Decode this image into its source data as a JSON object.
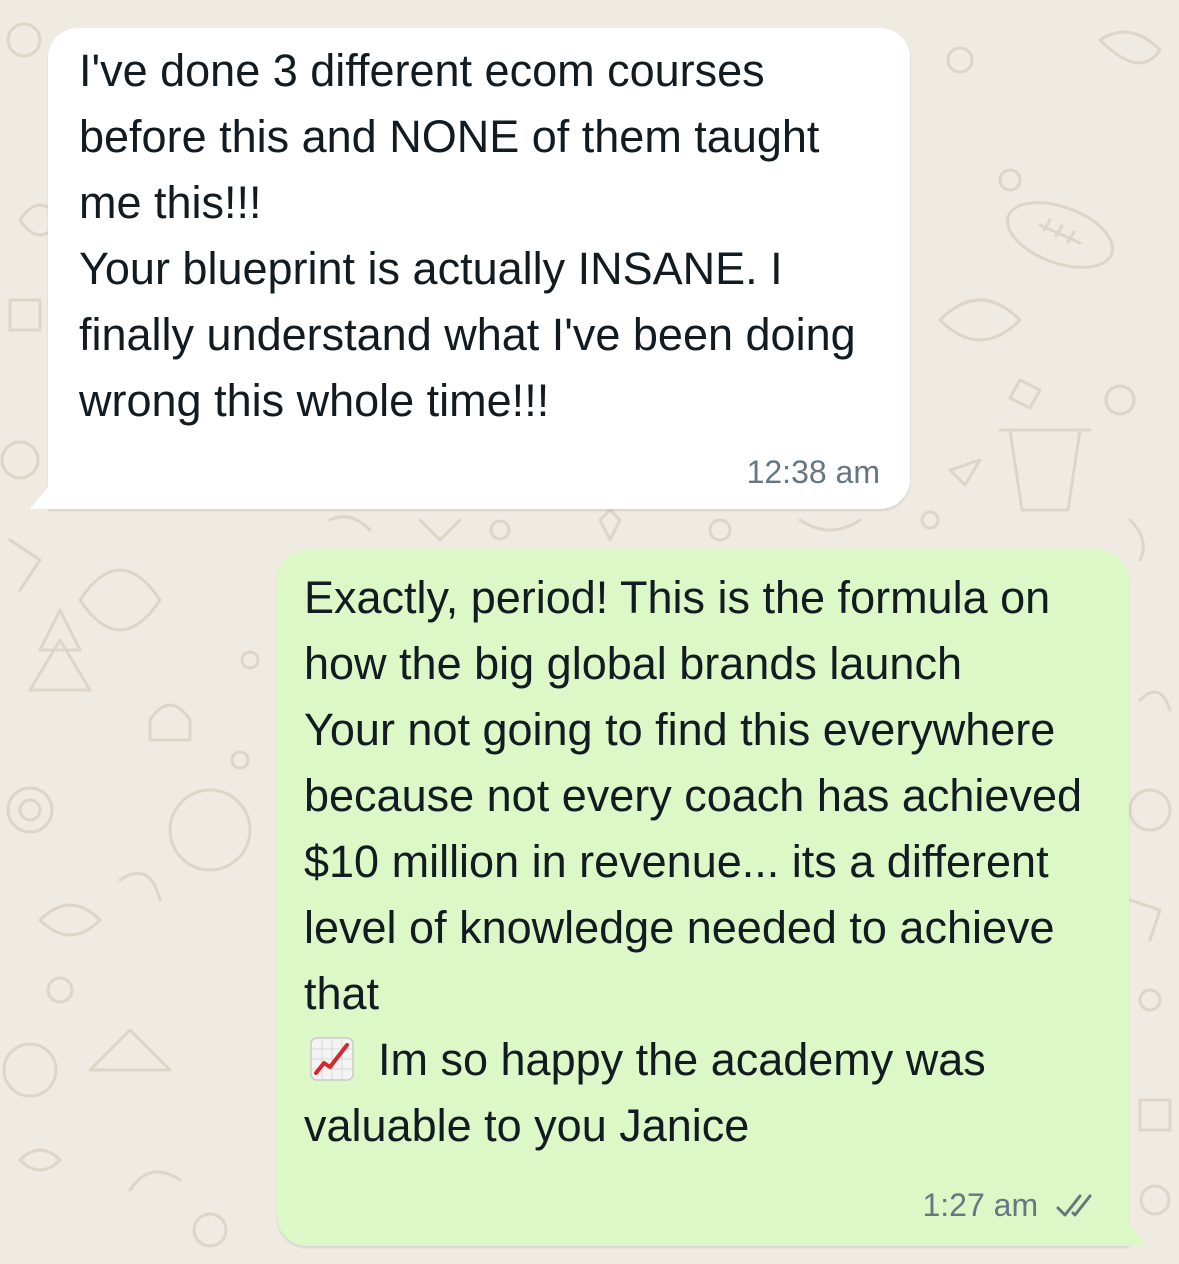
{
  "theme": {
    "wallpaper_color": "#efeae2",
    "incoming_bubble_color": "#ffffff",
    "outgoing_bubble_color": "#dcf8c6",
    "timestamp_color": "#667781"
  },
  "messages": [
    {
      "direction": "incoming",
      "text": "I've done 3 different ecom courses before this and NONE of them taught me this!!!\nYour blueprint is actually INSANE. I finally understand what I've been doing wrong this whole time!!!",
      "time": "12:38 am"
    },
    {
      "direction": "outgoing",
      "text_before_emoji": "Exactly, period! This is the formula on how the big global brands launch\nYour not going to find this everywhere because not every coach has achieved $10 million in revenue... its a different level of knowledge needed to achieve that\n",
      "emoji": "chart-increasing-icon",
      "text_after_emoji": "Im so happy the academy was valuable to you Janice",
      "time": "1:27 am",
      "status": "read-ticks-icon"
    }
  ]
}
